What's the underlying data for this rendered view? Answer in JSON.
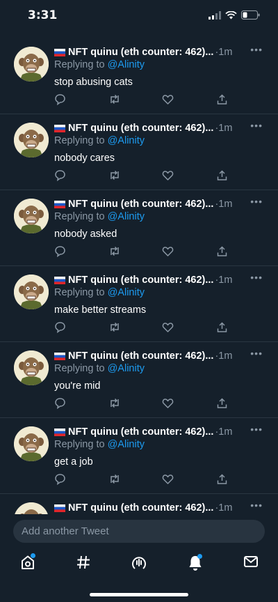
{
  "status_bar": {
    "time": "3:31"
  },
  "tweets": [
    {
      "author": "NFT quinu (eth counter: 462)...",
      "time": "1m",
      "replying_label": "Replying to",
      "reply_to": "@Alinity",
      "text": "stop abusing cats"
    },
    {
      "author": "NFT quinu (eth counter: 462)...",
      "time": "1m",
      "replying_label": "Replying to",
      "reply_to": "@Alinity",
      "text": "nobody cares"
    },
    {
      "author": "NFT quinu (eth counter: 462)...",
      "time": "1m",
      "replying_label": "Replying to",
      "reply_to": "@Alinity",
      "text": "nobody asked"
    },
    {
      "author": "NFT quinu (eth counter: 462)...",
      "time": "1m",
      "replying_label": "Replying to",
      "reply_to": "@Alinity",
      "text": "make better streams"
    },
    {
      "author": "NFT quinu (eth counter: 462)...",
      "time": "1m",
      "replying_label": "Replying to",
      "reply_to": "@Alinity",
      "text": "you're mid"
    },
    {
      "author": "NFT quinu (eth counter: 462)...",
      "time": "1m",
      "replying_label": "Replying to",
      "reply_to": "@Alinity",
      "text": "get a job"
    },
    {
      "author": "NFT quinu (eth counter: 462)...",
      "time": "1m",
      "replying_label": "",
      "reply_to": "",
      "text": ""
    }
  ],
  "composer": {
    "placeholder": "Add another Tweet"
  },
  "tab_bar": {
    "items": [
      {
        "icon": "home-icon",
        "badge": true
      },
      {
        "icon": "hashtag-icon",
        "badge": false
      },
      {
        "icon": "spaces-icon",
        "badge": false
      },
      {
        "icon": "bell-icon",
        "badge": true
      },
      {
        "icon": "mail-icon",
        "badge": false
      }
    ]
  },
  "colors": {
    "background": "#15202b",
    "divider": "#2a3642",
    "muted_text": "#8b98a5",
    "accent": "#1d9bf0"
  }
}
